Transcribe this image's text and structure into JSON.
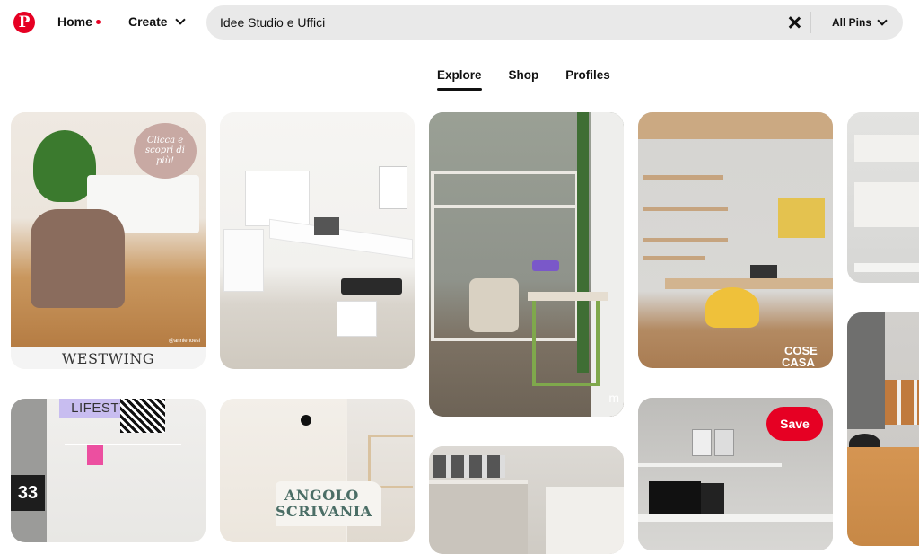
{
  "header": {
    "logo": "P",
    "home_label": "Home",
    "create_label": "Create",
    "search_value": "Idee Studio e Uffici",
    "filter_label": "All Pins"
  },
  "tabs": [
    {
      "label": "Explore",
      "active": true
    },
    {
      "label": "Shop",
      "active": false
    },
    {
      "label": "Profiles",
      "active": false
    }
  ],
  "pins": [
    {
      "id": "westwing-desk",
      "bubble": "Clicca e scopri di più!",
      "caption": "WESTWING",
      "credit": "@anniehoesl"
    },
    {
      "id": "white-corner-desk"
    },
    {
      "id": "green-leaf-office",
      "watermark": "m"
    },
    {
      "id": "corner-shelves-yellow",
      "watermark_top": "COSE",
      "watermark_bottom": "CASA"
    },
    {
      "id": "white-bookshelf"
    },
    {
      "id": "lifestyle-wall",
      "badge": "LIFESTYLE",
      "number": "33"
    },
    {
      "id": "angolo-scrivania",
      "title_line1": "ANGOLO",
      "title_line2": "SCRIVANIA"
    },
    {
      "id": "grey-library"
    },
    {
      "id": "monochrome-desk",
      "save_label": "Save"
    },
    {
      "id": "wood-cabinet"
    }
  ],
  "colors": {
    "brand": "#e60023",
    "search_bg": "#e9e9e9"
  }
}
